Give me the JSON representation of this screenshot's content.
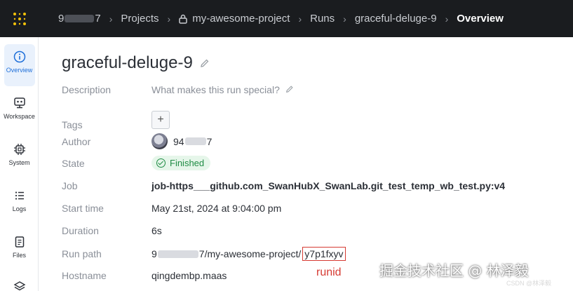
{
  "breadcrumb": {
    "user_prefix": "9",
    "user_suffix": "7",
    "projects": "Projects",
    "project": "my-awesome-project",
    "runs": "Runs",
    "run": "graceful-deluge-9",
    "current": "Overview",
    "separator": "›"
  },
  "sidebar": {
    "items": [
      {
        "label": "Overview",
        "icon": "info-icon",
        "active": true
      },
      {
        "label": "Workspace",
        "icon": "workspace-icon"
      },
      {
        "label": "System",
        "icon": "chip-icon"
      },
      {
        "label": "Logs",
        "icon": "list-icon"
      },
      {
        "label": "Files",
        "icon": "file-icon"
      }
    ]
  },
  "run": {
    "title": "graceful-deluge-9",
    "fields": {
      "description": {
        "label": "Description",
        "placeholder": "What makes this run special?"
      },
      "tags": {
        "label": "Tags",
        "add": "+"
      },
      "author": {
        "label": "Author",
        "prefix": "94",
        "suffix": "7"
      },
      "state": {
        "label": "State",
        "value": "Finished"
      },
      "job": {
        "label": "Job",
        "value": "job-https___github.com_SwanHubX_SwanLab.git_test_temp_wb_test.py:v4"
      },
      "start_time": {
        "label": "Start time",
        "value": "May 21st, 2024 at 9:04:00 pm"
      },
      "duration": {
        "label": "Duration",
        "value": "6s"
      },
      "run_path": {
        "label": "Run path",
        "prefix": "9",
        "middle": "7/my-awesome-project/",
        "runid": "y7p1fxyv"
      },
      "hostname": {
        "label": "Hostname",
        "value": "qingdembp.maas"
      }
    }
  },
  "annotation": {
    "runid_note": "runid"
  },
  "watermark": {
    "text": "掘金技术社区 @ 林泽毅",
    "small": "CSDN @林泽毅"
  },
  "colors": {
    "accent": "#1e6fd9",
    "link": "#0f7a85",
    "success": "#1f8c44",
    "annotation": "#d63a32",
    "logo": "#f5c20a"
  }
}
